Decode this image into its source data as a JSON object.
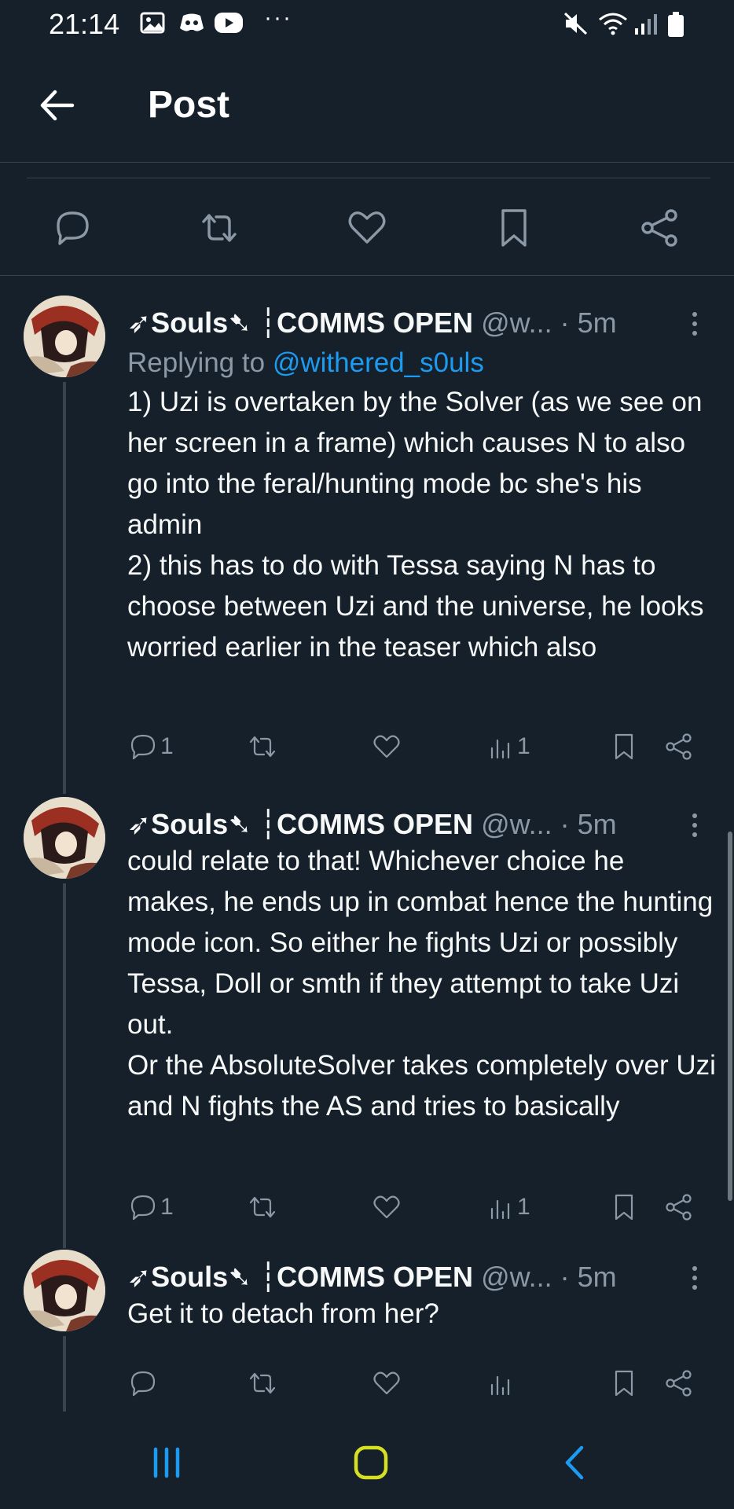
{
  "status_bar": {
    "time": "21:14",
    "more": "···",
    "icons": [
      "gallery-icon",
      "discord-icon",
      "youtube-icon",
      "mute-icon",
      "wifi-icon",
      "signal-icon",
      "battery-icon"
    ]
  },
  "header": {
    "title": "Post",
    "back_icon": "arrow-left-icon"
  },
  "main_post_actions": [
    "reply-icon",
    "repost-icon",
    "like-icon",
    "bookmark-icon",
    "share-icon"
  ],
  "replies": [
    {
      "display_name": "➶Souls➷ ┆COMMS OPEN",
      "handle": "@w...",
      "separator": "·",
      "time": "5m",
      "replying_prefix": "Replying to ",
      "replying_to": "@withered_s0uls",
      "text": "1) Uzi is overtaken by the Solver (as we see on her screen in a frame) which causes N to also go into the feral/hunting mode bc she's his admin\n2) this has to do with Tessa saying N has to choose between Uzi and the universe, he looks worried earlier in the teaser which also",
      "reply_count": "1",
      "views_count": "1"
    },
    {
      "display_name": "➶Souls➷ ┆COMMS OPEN",
      "handle": "@w...",
      "separator": "·",
      "time": "5m",
      "text": "could relate to that! Whichever choice he makes, he ends up in combat hence the hunting mode icon. So either he fights Uzi or possibly  Tessa, Doll or smth if they attempt to take Uzi out.\nOr the AbsoluteSolver takes completely over Uzi and N fights the AS and tries to basically",
      "reply_count": "1",
      "views_count": "1"
    },
    {
      "display_name": "➶Souls➷ ┆COMMS OPEN",
      "handle": "@w...",
      "separator": "·",
      "time": "5m",
      "text": "Get it to detach from her?",
      "reply_count": "",
      "views_count": ""
    }
  ],
  "nav_bar": {
    "icons": [
      "recents-icon",
      "home-icon",
      "back-icon"
    ]
  },
  "colors": {
    "background": "#15202b",
    "accent": "#1d9bf0",
    "muted": "#8b98a5",
    "divider": "#38444d"
  }
}
